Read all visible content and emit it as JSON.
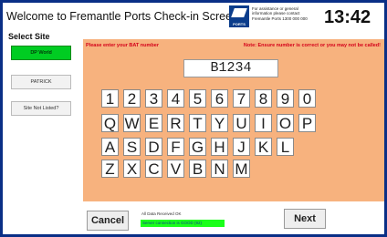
{
  "header": {
    "title": "Welcome to Fremantle Ports Check-in Screen.",
    "logo_text": "PORTS",
    "help_text": "For assistance or general information please contact Fremantle Ports 1300 000 000",
    "clock": "13:42"
  },
  "sidebar": {
    "title": "Select Site",
    "sites": [
      {
        "label": "DP World",
        "active": true
      },
      {
        "label": "PATRICK",
        "active": false
      },
      {
        "label": "Site Not Listed?",
        "active": false
      }
    ]
  },
  "form": {
    "prompt": "Please enter your BAT number",
    "warning": "Note: Ensure number is correct or you may not be called!",
    "bat_value": "B1234"
  },
  "keyboard": {
    "rows": [
      [
        "1",
        "2",
        "3",
        "4",
        "5",
        "6",
        "7",
        "8",
        "9",
        "0"
      ],
      [
        "Q",
        "W",
        "E",
        "R",
        "T",
        "Y",
        "U",
        "I",
        "O",
        "P"
      ],
      [
        "A",
        "S",
        "D",
        "F",
        "G",
        "H",
        "J",
        "K",
        "L"
      ],
      [
        "Z",
        "X",
        "C",
        "V",
        "B",
        "N",
        "M"
      ]
    ]
  },
  "footer": {
    "cancel_label": "Cancel",
    "next_label": "Next",
    "status_label": "All Data Received OK",
    "status_text": "Server connection is GOOD (92)"
  },
  "colors": {
    "frame": "#0a2f86",
    "panel": "#f7b27e",
    "active_site": "#00cc22",
    "alert_text": "#d4001a",
    "status_ok": "#1aff1a"
  }
}
